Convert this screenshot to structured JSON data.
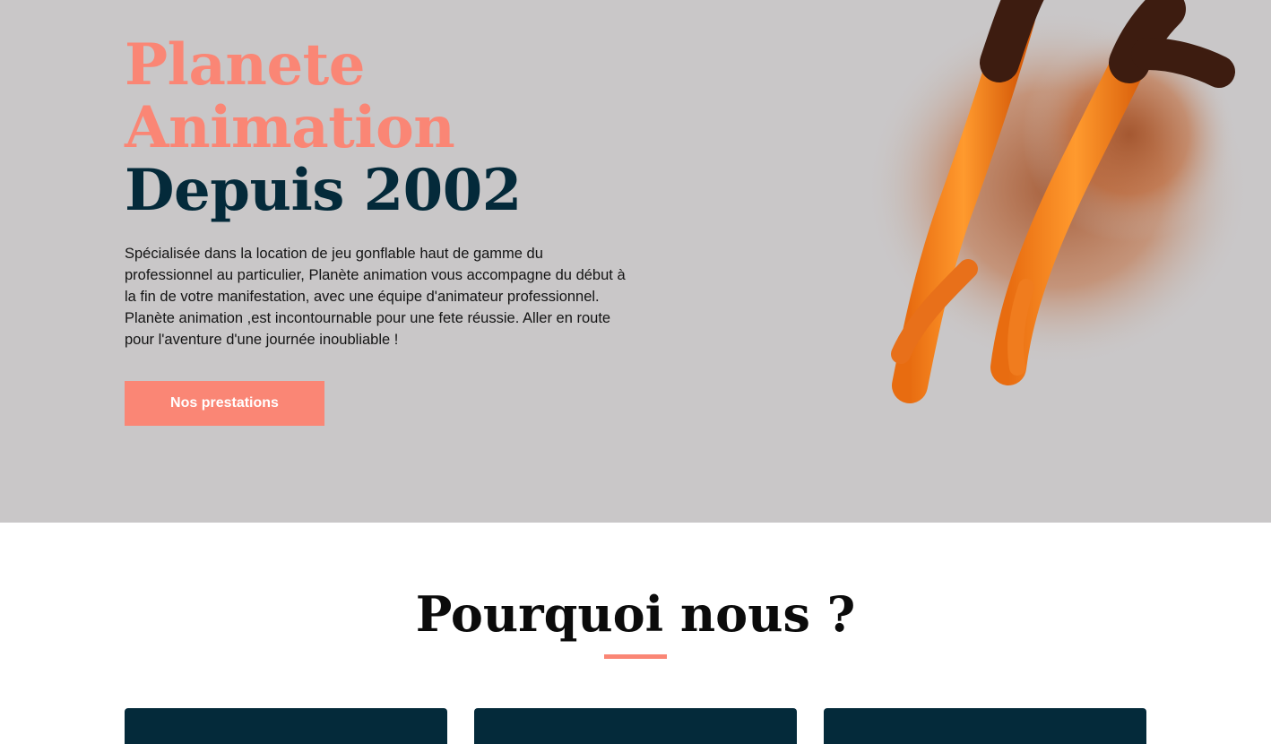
{
  "hero": {
    "title_line1": "Planete",
    "title_line2": "Animation",
    "title_line3": "Depuis 2002",
    "description": "Spécialisée dans la location de jeu gonflable haut de gamme du professionnel au particulier, Planète animation vous accompagne du début à la fin de votre manifestation, avec une équipe d'animateur professionnel. Planète animation ,est incontournable pour une fete réussie. Aller en route pour l'aventure d'une journée inoubliable !",
    "cta_label": "Nos prestations",
    "image_icon": "churros-image"
  },
  "why_section": {
    "title": "Pourquoi nous ?"
  },
  "colors": {
    "accent": "#fa8675",
    "dark": "#042a3a",
    "hero_bg": "#c9c7c8"
  }
}
